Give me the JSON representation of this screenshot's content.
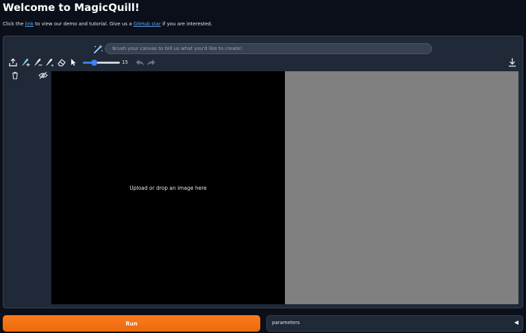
{
  "header": {
    "title": "Welcome to MagicQuill!",
    "intro_prefix": "Click the ",
    "intro_link1": "link",
    "intro_middle": " to view our demo and tutorial. Give us a ",
    "intro_link2": "GitHub star",
    "intro_suffix": " if you are interested."
  },
  "prompt": {
    "placeholder": "Brush your canvas to tell us what you'd like to create!"
  },
  "toolbar": {
    "brush_size": 15,
    "brush_size_max": 50,
    "icons": [
      "upload-icon",
      "add-brush-icon",
      "subtract-brush-icon",
      "color-brush-icon",
      "eraser-icon",
      "cursor-icon",
      "undo-icon",
      "redo-icon",
      "download-icon",
      "delete-icon",
      "hide-icon"
    ]
  },
  "canvas": {
    "upload_text": "Upload or drop an image here"
  },
  "actions": {
    "run_label": "Run",
    "parameters_label": "parameters",
    "parameters_toggle": "◀"
  },
  "colors": {
    "background": "#0b0f19",
    "panel": "#1f2937",
    "run_button": "#f97316",
    "link": "#60a5fa",
    "slider": "#3b82f6",
    "preview_canvas": "#808080"
  }
}
